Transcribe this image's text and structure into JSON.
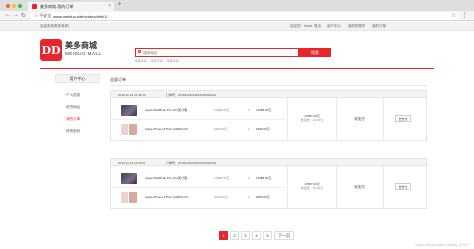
{
  "browser": {
    "tab_title": "美多商城-我的订单",
    "tab_close": "×",
    "new_tab": "+",
    "url_prefix": "ⓘ 不安全",
    "url": "www.meiduo.site/orders/info/1/"
  },
  "topnav": {
    "welcome": "欢迎来到美多商城!",
    "links": [
      "欢迎您：itcast",
      "退出",
      "用户中心",
      "我的购物车",
      "我的订单"
    ]
  },
  "logo": {
    "mark": "DD",
    "name_cn": "美多商城",
    "name_en": "MEIDUO MALL"
  },
  "search": {
    "placeholder": "搜索商品",
    "button": "搜索",
    "hot": [
      "苹果手机",
      "香蕉手机",
      "苹果手机"
    ]
  },
  "sidebar": {
    "title": "用户中心",
    "items": [
      "· 个人信息",
      "· 收货地址",
      "· 我的订单",
      "· 修改密码"
    ],
    "active_index": 2
  },
  "main": {
    "title": "全部订单"
  },
  "orders": [
    {
      "date": "2018-11-03 22:48:16",
      "number": "订单号：20181103224816000000001",
      "items": [
        {
          "kind": "mac",
          "name": "Apple MacBook Pro 13.3英寸笔...",
          "unit": "11388.00元",
          "qty": "1",
          "subtotal": "11388.00元"
        },
        {
          "kind": "iphone",
          "name": "Apple iPhone 8 Plus (A1864) 64...",
          "unit": "6499.00元",
          "qty": "1",
          "subtotal": "6499.00元"
        }
      ],
      "total": "17897.00元",
      "fee": "含运费：10.00元",
      "status": "待支付",
      "action": "去支付"
    },
    {
      "date": "2018-11-03 22:09:01",
      "number": "订单号：20181103220901000000001",
      "items": [
        {
          "kind": "mac",
          "name": "Apple MacBook Pro 13.3英寸笔...",
          "unit": "11388.00元",
          "qty": "1",
          "subtotal": "11388.00元"
        },
        {
          "kind": "iphone",
          "name": "Apple iPhone 8 Plus (A1864) 64...",
          "unit": "6499.00元",
          "qty": "1",
          "subtotal": "6499.00元"
        }
      ],
      "total": "17897.00元",
      "fee": "含运费：10.00元",
      "status": "待支付",
      "action": "去支付"
    }
  ],
  "pagination": {
    "pages": [
      "1",
      "2",
      "3",
      "4",
      "5"
    ],
    "current": "1",
    "next": "下一页"
  },
  "colors": {
    "brand": "#e7262b"
  },
  "watermark": "https://blog.csdn.net/qq_41977"
}
